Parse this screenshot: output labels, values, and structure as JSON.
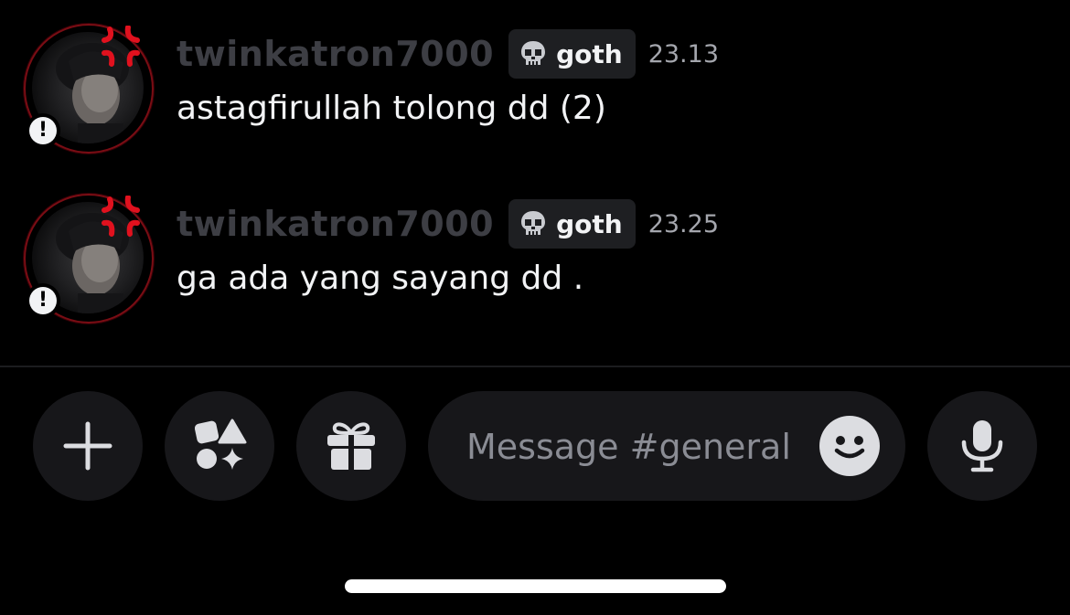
{
  "messages": [
    {
      "username": "twinkatron7000",
      "tag": "goth",
      "timestamp": "23.13",
      "text": "astagfirullah tolong dd (2)"
    },
    {
      "username": "twinkatron7000",
      "tag": "goth",
      "timestamp": "23.25",
      "text": "ga ada yang sayang dd ."
    }
  ],
  "composer": {
    "placeholder": "Message #general",
    "buttons": {
      "plus": "plus-icon",
      "apps": "apps-icon",
      "gift": "gift-icon",
      "emoji": "smiley-icon",
      "mic": "microphone-icon"
    }
  },
  "colors": {
    "background": "#000000",
    "username": "#3d3e44",
    "message_text": "#f2f3f5",
    "timestamp": "#a4a6ad",
    "tag_background": "#1e1f22",
    "button_background": "#17171a",
    "avatar_decoration_red": "#e0111e"
  }
}
